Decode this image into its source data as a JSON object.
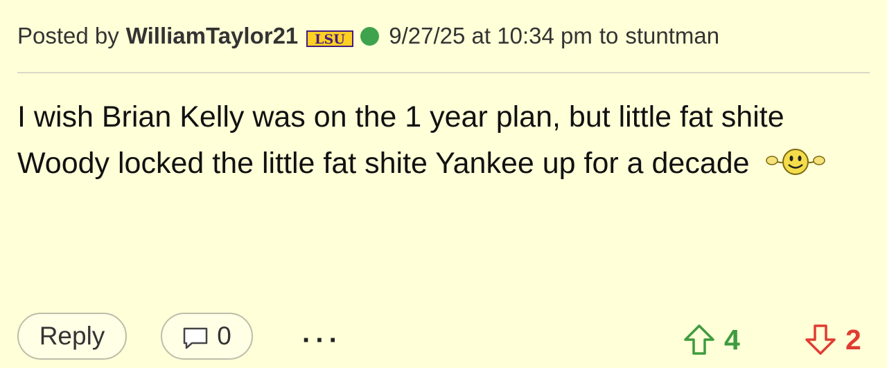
{
  "post": {
    "posted_by_label": "Posted by",
    "username": "WilliamTaylor21",
    "team_badge_text": "LSU",
    "timestamp": "9/27/25 at 10:34 pm",
    "to_label": "to",
    "reply_to_user": "stuntman",
    "body_text": "I wish Brian Kelly was on the 1 year plan, but little fat shite Woody locked the little fat shite Yankee up for a decade",
    "emoji_icon": "muscle-smiley-icon"
  },
  "actions": {
    "reply_label": "Reply",
    "comment_count": "0",
    "more_label": "···",
    "upvotes": "4",
    "downvotes": "2"
  },
  "colors": {
    "background": "#FFFFD8",
    "online": "#3FA34D",
    "upvote": "#3E9B3E",
    "downvote": "#E03C31",
    "lsu_purple": "#461D7C",
    "lsu_gold": "#FDD023"
  }
}
